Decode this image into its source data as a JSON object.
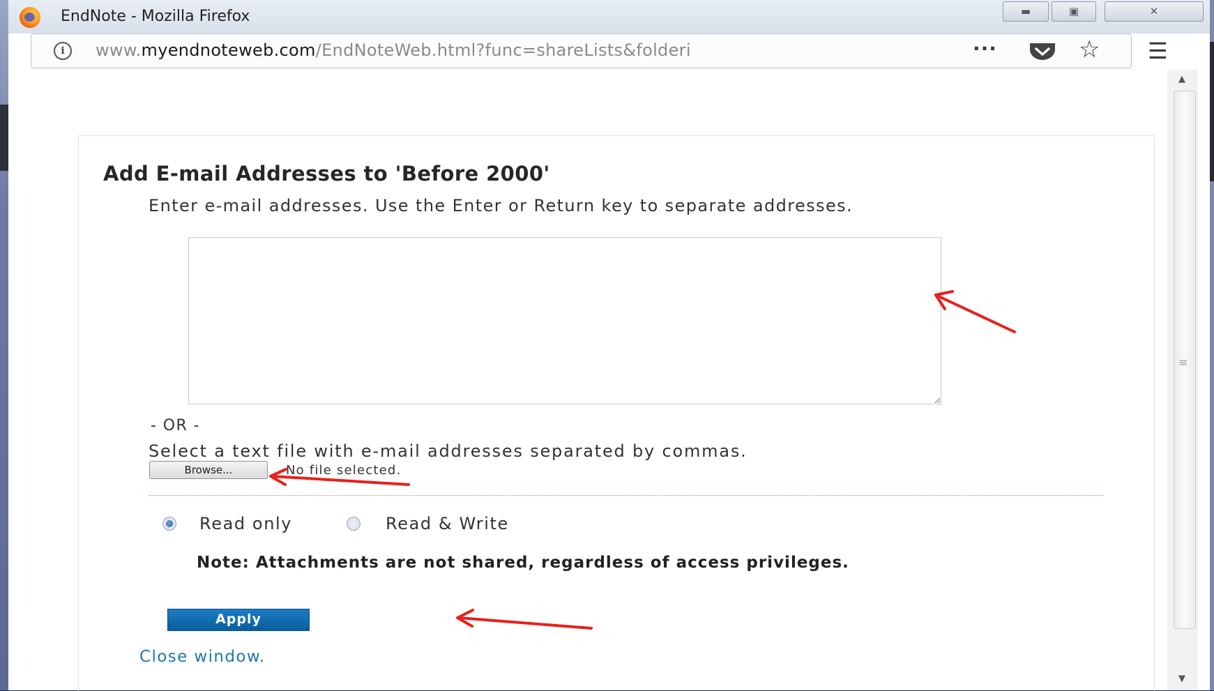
{
  "browser": {
    "window_title": "EndNote - Mozilla Firefox",
    "url_prefix": "www.",
    "url_host": "myendnoteweb.com",
    "url_path": "/EndNoteWeb.html?func=shareLists&folderi",
    "icons": [
      "info-icon",
      "page-actions-icon",
      "pocket-icon",
      "bookmark-star-icon",
      "menu-icon",
      "minimize-icon",
      "maximize-icon",
      "close-icon"
    ]
  },
  "dialog": {
    "heading": "Add E-mail Addresses to 'Before 2000'",
    "instructions": "Enter e-mail addresses. Use the Enter or Return key to separate addresses.",
    "email_textarea_value": "",
    "or_separator": "- OR -",
    "file_instructions": "Select a text file with e-mail addresses separated by commas.",
    "browse_label": "Browse...",
    "file_status": "No file selected.",
    "access": {
      "options": [
        "Read only",
        "Read & Write"
      ],
      "selected": "Read only"
    },
    "note": "Note: Attachments are not shared, regardless of access privileges.",
    "apply_label": "Apply",
    "close_link": "Close window."
  },
  "colors": {
    "annotation_arrow": "#e8201a",
    "apply_button": "#0e66a8",
    "link": "#1e77b3"
  }
}
